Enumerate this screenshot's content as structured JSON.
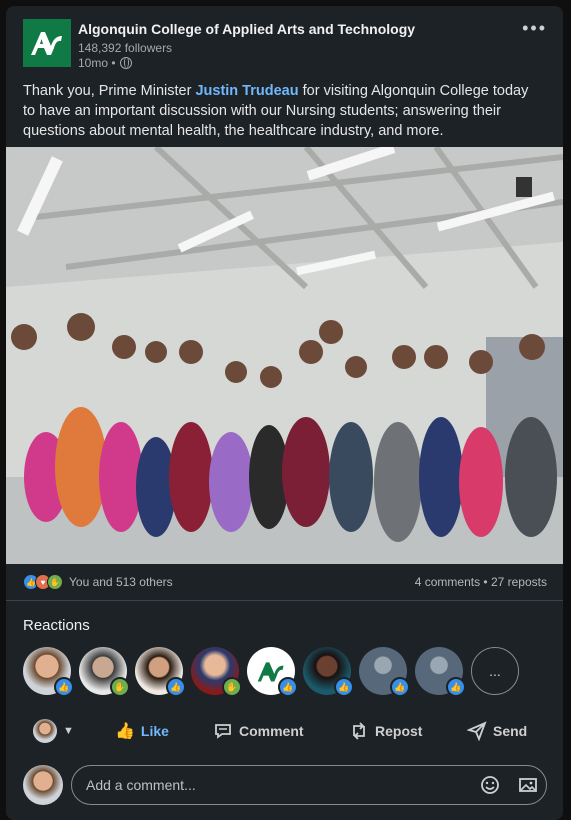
{
  "post": {
    "org_name": "Algonquin College of Applied Arts and Technology",
    "followers": "148,392 followers",
    "time": "10mo •",
    "more_label": "•••",
    "text_before": "Thank you, Prime Minister ",
    "mention": "Justin Trudeau",
    "text_after": " for visiting Algonquin College today to have an important discussion with our Nursing students; answering their questions about mental health, the healthcare industry, and more.",
    "photo_icon": "group-photo"
  },
  "stats": {
    "reactions_label": "You and 513 others",
    "comments_reposts": "4 comments • 27 reposts",
    "reaction_icons": [
      "like-icon",
      "love-icon",
      "support-icon"
    ]
  },
  "reactions": {
    "title": "Reactions",
    "more": "..."
  },
  "actions": {
    "like": "Like",
    "comment": "Comment",
    "repost": "Repost",
    "send": "Send"
  },
  "comment": {
    "placeholder": "Add a comment..."
  },
  "colors": {
    "card_bg": "#1d2226",
    "link": "#71b7fb",
    "brand_green": "#0f7a45"
  }
}
